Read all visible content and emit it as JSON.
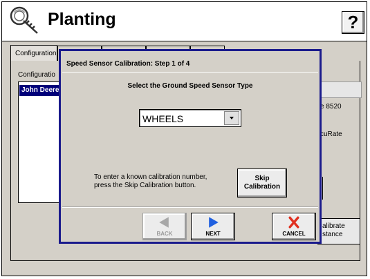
{
  "app": {
    "title": "Planting",
    "help_label": "?"
  },
  "tabs": [
    {
      "label": "Configuration"
    },
    {
      "label": ""
    },
    {
      "label": ""
    },
    {
      "label": ""
    }
  ],
  "background": {
    "configuration_label": "Configuratio",
    "selected_item": "John Deere",
    "right_text_1": "e 8520",
    "right_text_2": "cuRate",
    "calibrate_line1": "alibrate",
    "calibrate_line2": "stance"
  },
  "dialog": {
    "title": "Speed Sensor Calibration:  Step 1 of 4",
    "heading": "Select the Ground Speed Sensor Type",
    "sensor_type": {
      "selected": "WHEELS"
    },
    "hint_line1": "To enter a known calibration number,",
    "hint_line2": "press the Skip Calibration button.",
    "skip_line1": "Skip",
    "skip_line2": "Calibration",
    "back_label": "BACK",
    "next_label": "NEXT",
    "cancel_label": "CANCEL"
  },
  "colors": {
    "dialog_border": "#1a1a8c",
    "selection": "#00007a",
    "next_arrow": "#2060e0",
    "cancel_x": "#e03020"
  }
}
